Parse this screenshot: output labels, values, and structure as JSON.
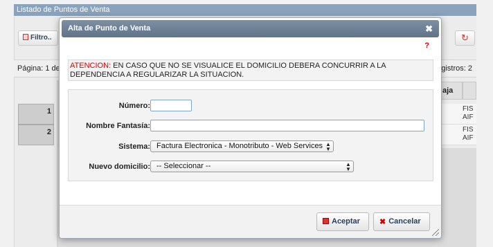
{
  "background": {
    "window_title": "Listado de Puntos de Venta",
    "filter_button": "Filtro..",
    "pager_left": "Página: 1 de",
    "pager_right": "gistros: 2",
    "column_header": "aja",
    "rows": [
      {
        "num": "1",
        "cell": "FIS AIF"
      },
      {
        "num": "2",
        "cell": "FIS AIF"
      }
    ]
  },
  "dialog": {
    "title": "Alta de Punto de Venta",
    "help": "?",
    "warning_label": "ATENCION:",
    "warning_text": " EN CASO QUE NO SE VISUALICE EL DOMICILIO DEBERA CONCURRIR A LA DEPENDENCIA A REGULARIZAR LA SITUACION.",
    "fields": {
      "numero_label": "Número:",
      "numero_value": "",
      "nombre_label": "Nombre Fantasía:",
      "nombre_value": "",
      "sistema_label": "Sistema:",
      "sistema_value": "Factura Electronica - Monotributo - Web Services",
      "domicilio_label": "Nuevo domicilio:",
      "domicilio_value": "-- Seleccionar --"
    },
    "accept_button": "Aceptar",
    "cancel_button": "Cancelar"
  }
}
